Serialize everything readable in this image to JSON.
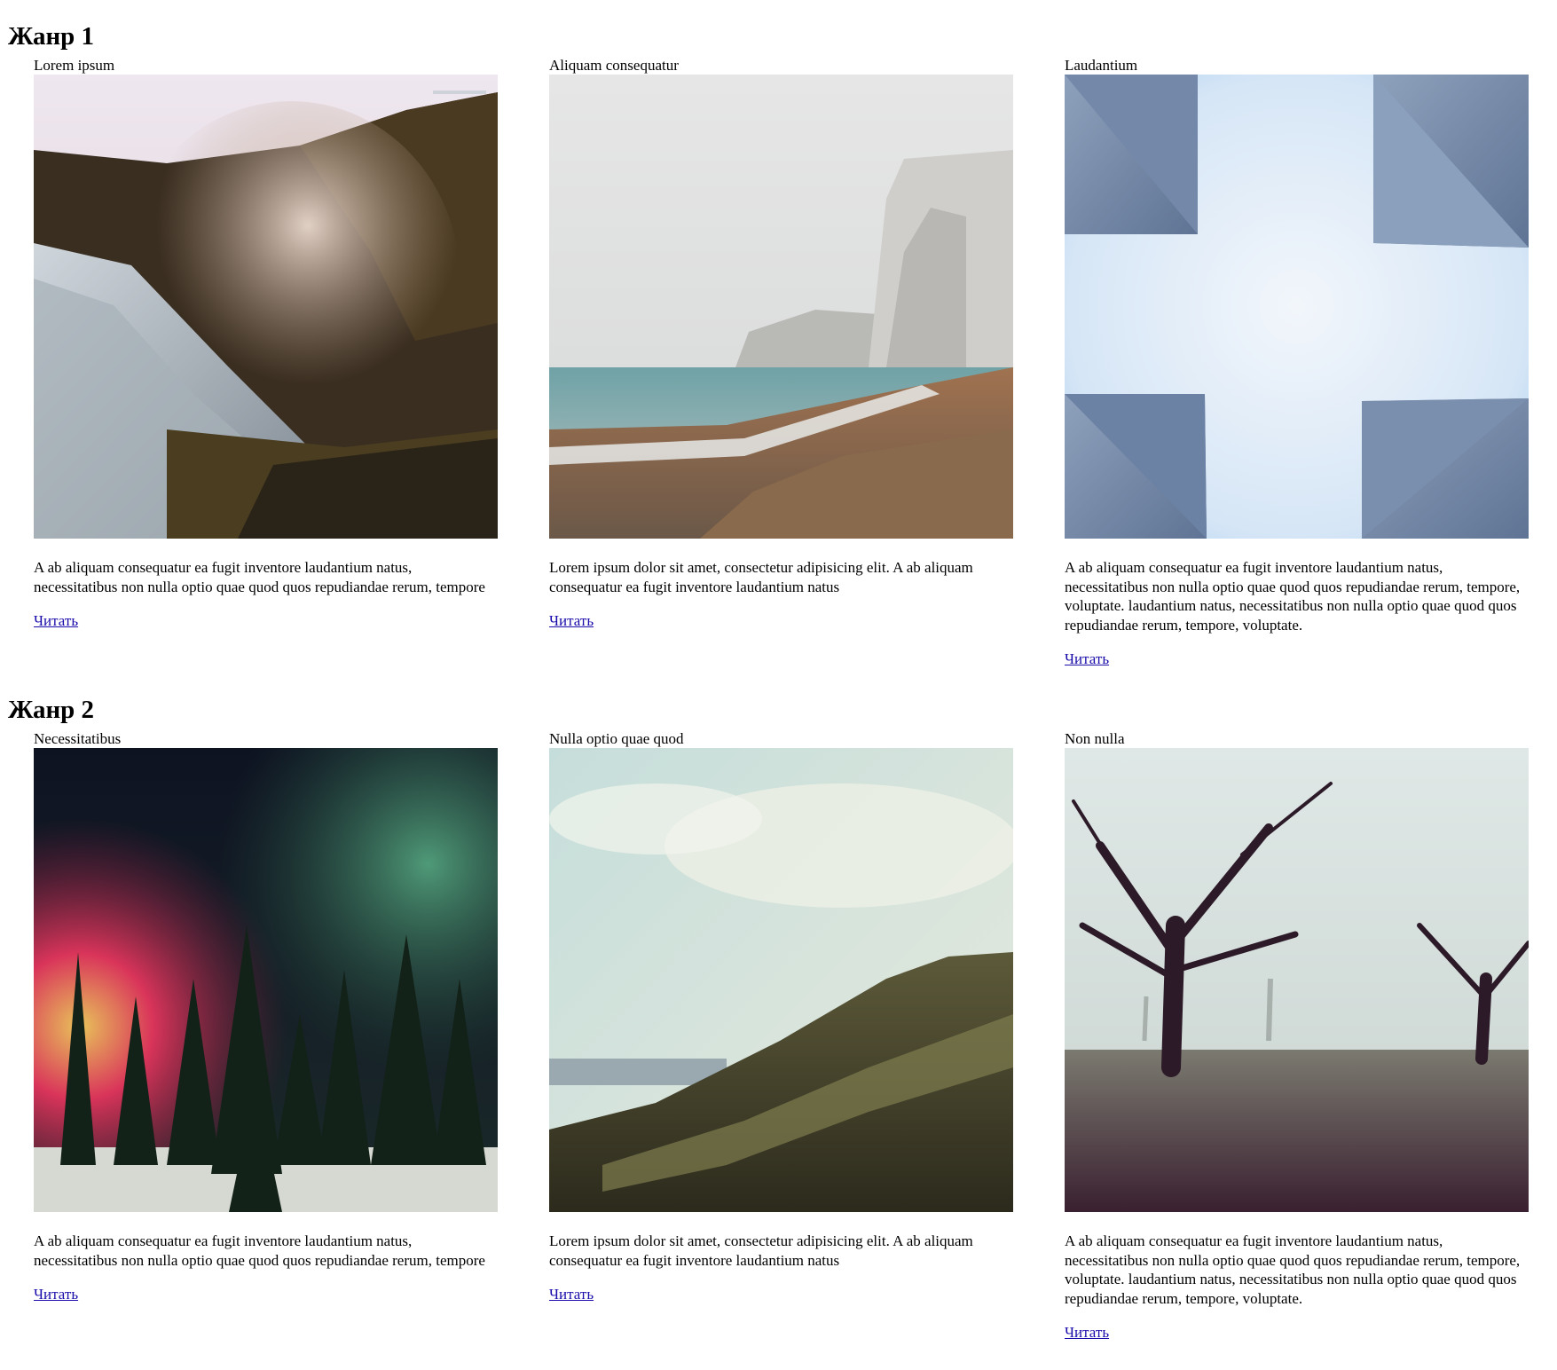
{
  "genres": [
    {
      "title": "Жанр 1",
      "cards": [
        {
          "title": "Lorem ipsum",
          "image": "waterfall-canyon-photo",
          "text": "A ab aliquam consequatur ea fugit inventore laudantium natus, necessitatibus non nulla optio quae quod quos repudiandae rerum, tempore",
          "link": "Читать"
        },
        {
          "title": "Aliquam consequatur",
          "image": "foggy-cliff-beach-photo",
          "text": "Lorem ipsum dolor sit amet, consectetur adipisicing elit. A ab aliquam consequatur ea fugit inventore laudantium natus",
          "link": "Читать"
        },
        {
          "title": "Laudantium",
          "image": "concrete-pillars-sky-photo",
          "text": "A ab aliquam consequatur ea fugit inventore laudantium natus, necessitatibus non nulla optio quae quod quos repudiandae rerum, tempore, voluptate. laudantium natus, necessitatibus non nulla optio quae quod quos repudiandae rerum, tempore, voluptate.",
          "link": "Читать"
        }
      ]
    },
    {
      "title": "Жанр 2",
      "cards": [
        {
          "title": "Necessitatibus",
          "image": "aurora-forest-photo",
          "text": "A ab aliquam consequatur ea fugit inventore laudantium natus, necessitatibus non nulla optio quae quod quos repudiandae rerum, tempore",
          "link": "Читать"
        },
        {
          "title": "Nulla optio quae quod",
          "image": "green-hill-sky-photo",
          "text": "Lorem ipsum dolor sit amet, consectetur adipisicing elit. A ab aliquam consequatur ea fugit inventore laudantium natus",
          "link": "Читать"
        },
        {
          "title": "Non nulla",
          "image": "misty-trees-park-photo",
          "text": "A ab aliquam consequatur ea fugit inventore laudantium natus, necessitatibus non nulla optio quae quod quos repudiandae rerum, tempore, voluptate. laudantium natus, necessitatibus non nulla optio quae quod quos repudiandae rerum, tempore, voluptate.",
          "link": "Читать"
        }
      ]
    }
  ],
  "colors": {
    "link": "#1a0dab",
    "text": "#000000",
    "background": "#ffffff"
  }
}
